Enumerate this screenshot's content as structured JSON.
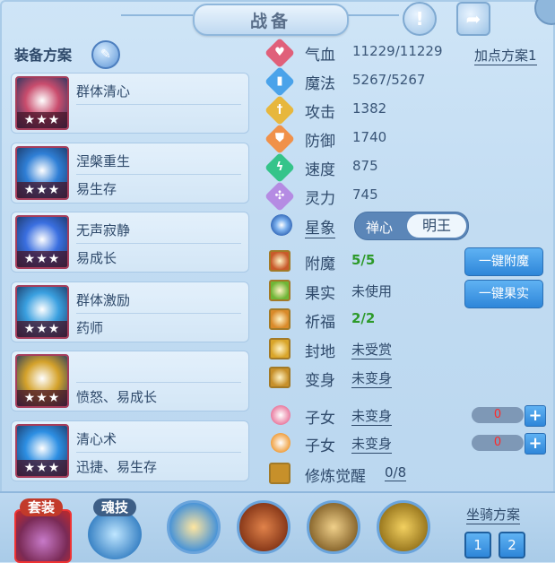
{
  "title": "战备",
  "top_buttons": {
    "info": "!",
    "share": "➦"
  },
  "plans": {
    "header": "装备方案",
    "items": [
      {
        "line1": "群体清心",
        "line2": "",
        "stars": "★★★",
        "color": "#c94c6d"
      },
      {
        "line1": "涅槃重生",
        "line2": "易生存",
        "stars": "★★★",
        "color": "#2f7fd6"
      },
      {
        "line1": "无声寂静",
        "line2": "易成长",
        "stars": "★★★",
        "color": "#3a6fe0"
      },
      {
        "line1": "群体激励",
        "line2": "药师",
        "stars": "★★★",
        "color": "#3aa0e0"
      },
      {
        "line1": "",
        "line2": "愤怒、易成长",
        "stars": "★★★",
        "color": "#d4a22b"
      },
      {
        "line1": "清心术",
        "line2": "迅捷、易生存",
        "stars": "★★★",
        "color": "#2d8fe3"
      }
    ]
  },
  "stats": [
    {
      "label": "气血",
      "value": "11229/11229",
      "icon": "heart-icon",
      "color": "#e0607a",
      "sym": "♥"
    },
    {
      "label": "魔法",
      "value": "5267/5267",
      "icon": "mana-icon",
      "color": "#4aa3ea",
      "sym": "▮"
    },
    {
      "label": "攻击",
      "value": "1382",
      "icon": "attack-icon",
      "color": "#e7b73d",
      "sym": "†"
    },
    {
      "label": "防御",
      "value": "1740",
      "icon": "defense-icon",
      "color": "#f0914a",
      "sym": "⛊"
    },
    {
      "label": "速度",
      "value": "875",
      "icon": "speed-icon",
      "color": "#35c48a",
      "sym": "ϟ"
    },
    {
      "label": "灵力",
      "value": "745",
      "icon": "spirit-icon",
      "color": "#b58be3",
      "sym": "✣"
    }
  ],
  "add_plan": "加点方案1",
  "star_sign": {
    "label": "星象",
    "option1": "禅心",
    "option2": "明王"
  },
  "extras": [
    {
      "label": "附魔",
      "value": "5/5",
      "style": "green",
      "icon": "enchant-icon",
      "color": "#c85a2a"
    },
    {
      "label": "果实",
      "value": "未使用",
      "style": "plain",
      "icon": "fruit-icon",
      "color": "#6fb536"
    },
    {
      "label": "祈福",
      "value": "2/2",
      "style": "green",
      "icon": "blessing-icon",
      "color": "#d98a2a"
    },
    {
      "label": "封地",
      "value": "未受赏",
      "style": "ul",
      "icon": "fief-icon",
      "color": "#d9a52a"
    },
    {
      "label": "变身",
      "value": "未变身",
      "style": "ul",
      "icon": "transform-icon",
      "color": "#c7902a"
    }
  ],
  "buttons": {
    "enchant": "一键附魔",
    "fruit": "一键果实"
  },
  "children": [
    {
      "label": "子女",
      "value": "未变身",
      "count": "0",
      "plus": "+",
      "icon": "child-girl-icon",
      "color": "#e97ca0"
    },
    {
      "label": "子女",
      "value": "未变身",
      "count": "0",
      "plus": "+",
      "icon": "child-boy-icon",
      "color": "#f0a040"
    }
  ],
  "awaken": {
    "label": "修炼觉醒",
    "value": "0/8"
  },
  "bottom": {
    "tab1": "套装",
    "tab2": "魂技",
    "mount_label": "坐骑方案",
    "mount_buttons": [
      "1",
      "2"
    ]
  }
}
